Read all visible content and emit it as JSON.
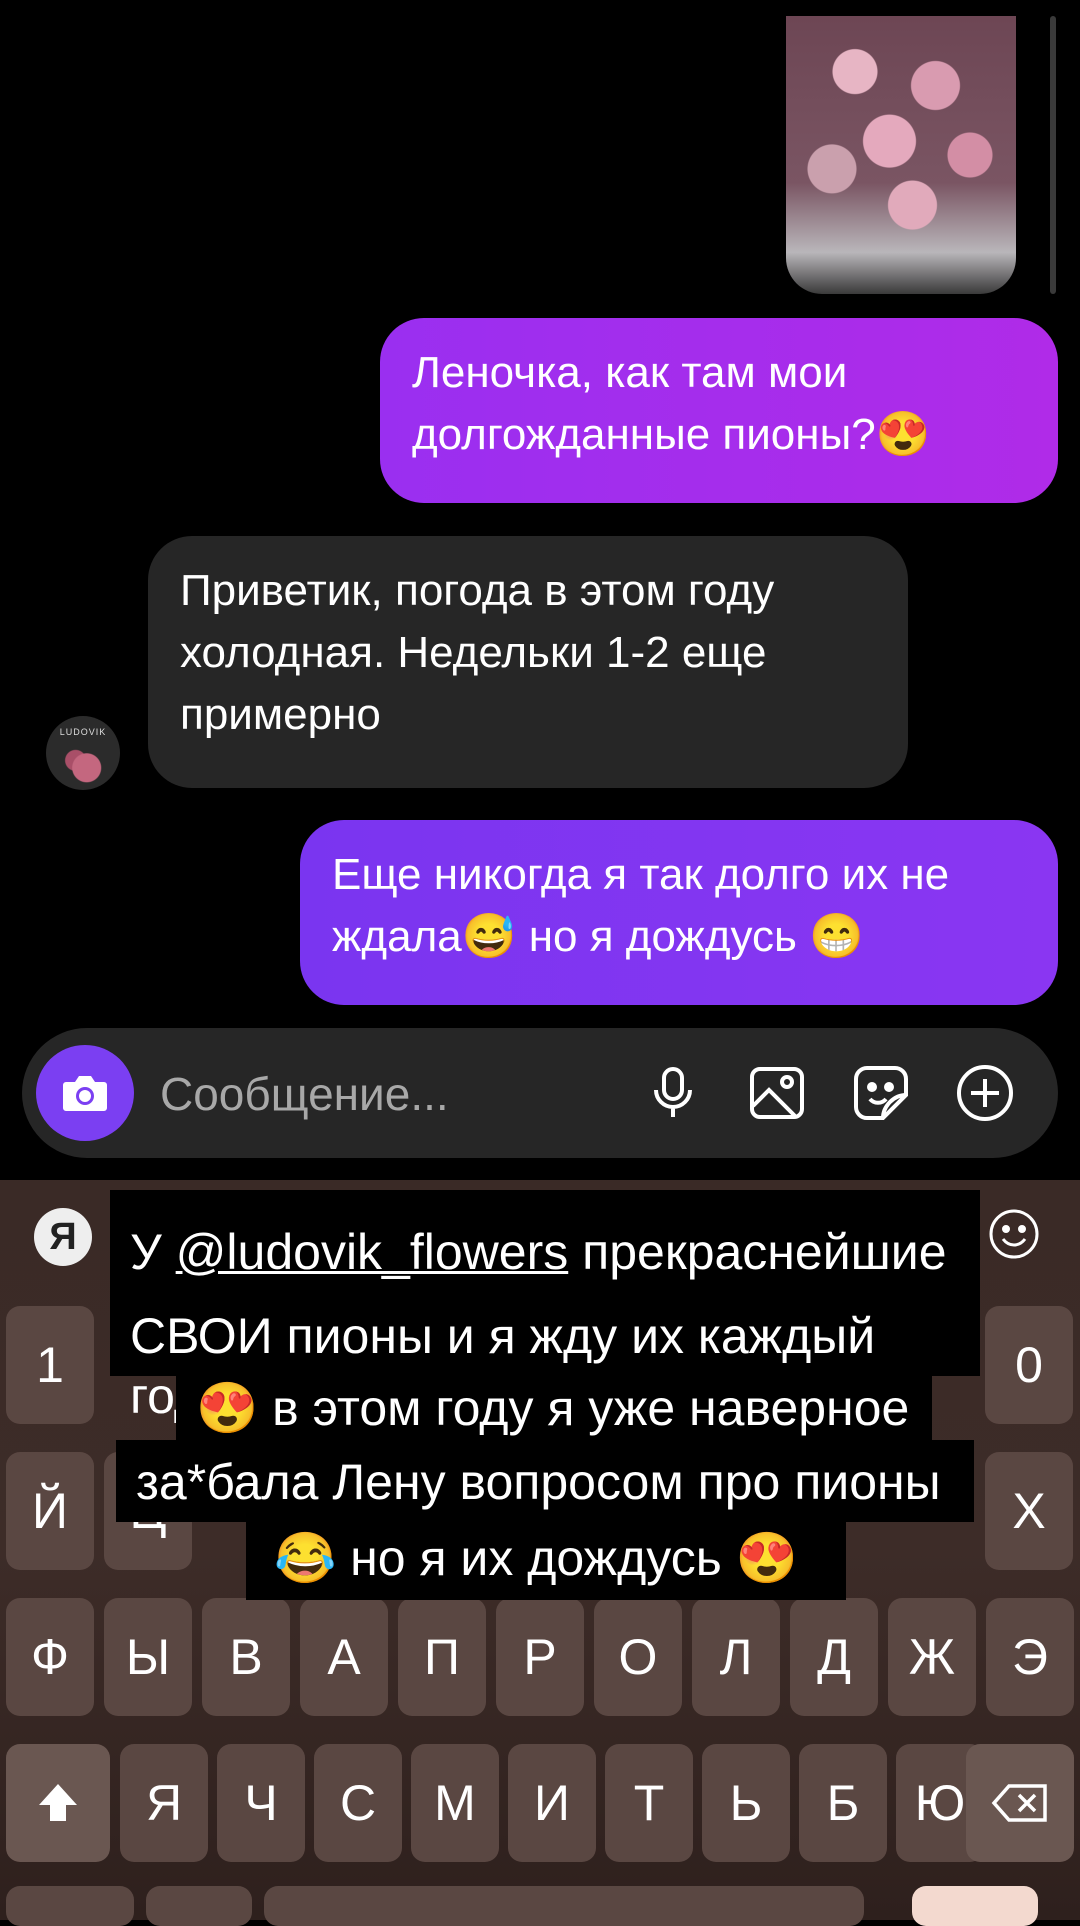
{
  "messages": [
    {
      "direction": "out",
      "text": "Леночка, как там мои долгожданные пионы?😍"
    },
    {
      "direction": "in",
      "text": "Приветик, погода в этом году холодная. Недельки 1-2 еще примерно"
    },
    {
      "direction": "out",
      "text": "Еще никогда я так долго их не ждала😅 но я дождусь 😁"
    }
  ],
  "avatar_label": "LUDOVIK",
  "composer": {
    "placeholder": "Сообщение..."
  },
  "icons": {
    "camera": "camera-icon",
    "mic": "mic-icon",
    "gallery": "gallery-icon",
    "sticker": "sticker-icon",
    "plus": "plus-icon",
    "smile": "smile-icon",
    "shift": "shift-icon",
    "backspace": "backspace-icon"
  },
  "keyboard": {
    "logo": "Я",
    "row_num_visible": [
      "1",
      "0"
    ],
    "row1_visible": [
      "Й",
      "Ц",
      "Х"
    ],
    "row2": [
      "Ф",
      "Ы",
      "В",
      "А",
      "П",
      "Р",
      "О",
      "Л",
      "Д",
      "Ж",
      "Э"
    ],
    "row3": [
      "Я",
      "Ч",
      "С",
      "М",
      "И",
      "Т",
      "Ь",
      "Б",
      "Ю"
    ]
  },
  "caption": {
    "line1_prefix": "У ",
    "mention": "@ludovik_flowers",
    "line1_suffix": " прекраснейшие",
    "line2": "СВОИ пионы и я жду их каждый год",
    "line3": "😍 в этом году я уже наверное",
    "line4": "за*бала Лену вопросом про пионы",
    "line5": "😂 но я их дождусь 😍"
  },
  "colors": {
    "accent_purple": "#9a2ff0",
    "accent_violet": "#7a35f0",
    "incoming": "#262626"
  }
}
